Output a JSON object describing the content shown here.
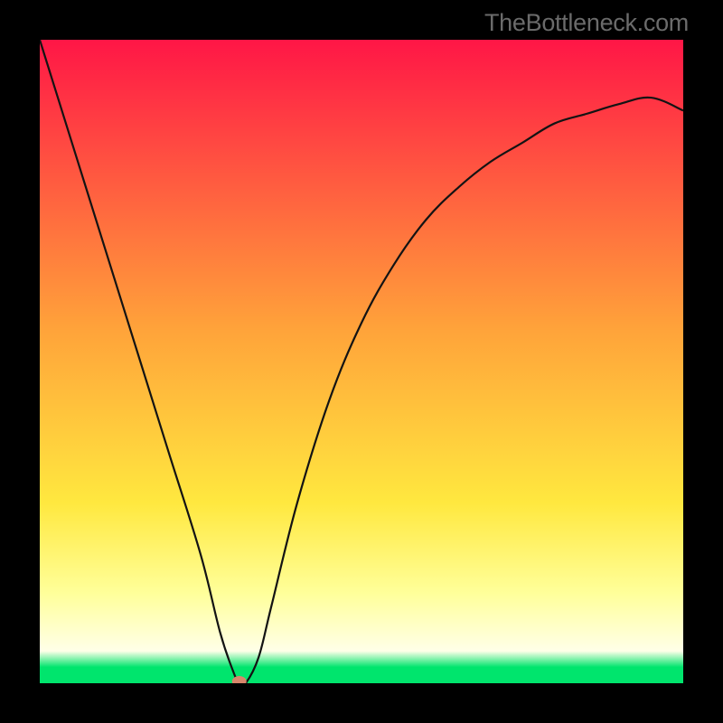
{
  "branding": "TheBottleneck.com",
  "colors": {
    "top": "#FF1646",
    "mid1": "#FFA33A",
    "mid2": "#FFE83F",
    "light": "#FFFF9A",
    "pale": "#FFFFE8",
    "green": "#00E56D",
    "black": "#000000",
    "dot": "#D8866B",
    "curve": "#131313"
  },
  "chart_data": {
    "type": "line",
    "title": "",
    "xlabel": "",
    "ylabel": "",
    "xlim": [
      0,
      100
    ],
    "ylim": [
      0,
      100
    ],
    "series": [
      {
        "name": "bottleneck-curve",
        "x": [
          0,
          5,
          10,
          15,
          20,
          25,
          28,
          30,
          31,
          32,
          34,
          36,
          40,
          45,
          50,
          55,
          60,
          65,
          70,
          75,
          80,
          85,
          90,
          95,
          100
        ],
        "y": [
          100,
          84,
          68,
          52,
          36,
          20,
          8,
          2,
          0,
          0,
          4,
          12,
          28,
          44,
          56,
          65,
          72,
          77,
          81,
          84,
          87,
          88.5,
          90,
          91,
          89
        ]
      },
      {
        "name": "optimum-point",
        "x": [
          31
        ],
        "y": [
          0
        ]
      }
    ]
  }
}
